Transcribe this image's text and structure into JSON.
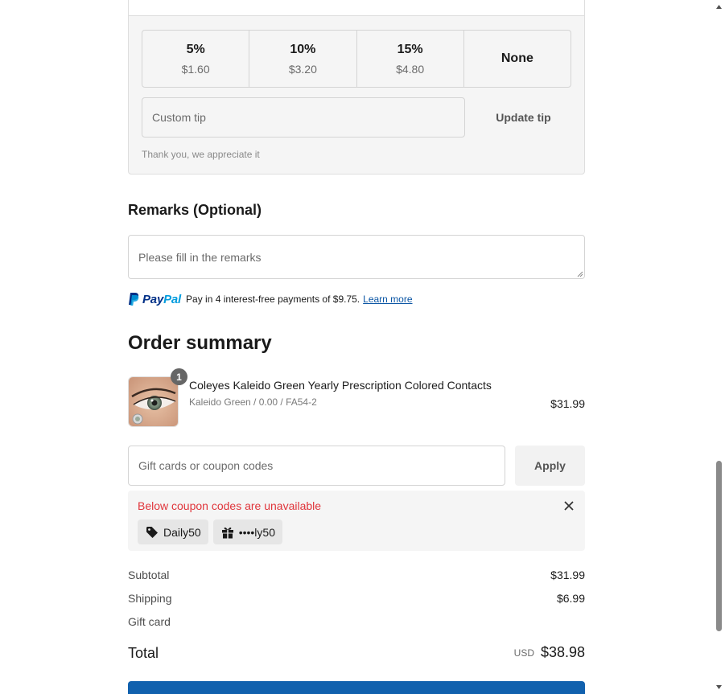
{
  "tip": {
    "options": [
      {
        "percent": "5%",
        "amount": "$1.60"
      },
      {
        "percent": "10%",
        "amount": "$3.20"
      },
      {
        "percent": "15%",
        "amount": "$4.80"
      }
    ],
    "none_label": "None",
    "custom_placeholder": "Custom tip",
    "update_label": "Update tip",
    "thanks_text": "Thank you, we appreciate it"
  },
  "remarks": {
    "title": "Remarks (Optional)",
    "placeholder": "Please fill in the remarks"
  },
  "paypal": {
    "logo_pay": "Pay",
    "logo_pal": "Pal",
    "message": "Pay in 4 interest-free payments of $9.75.",
    "learn_more": "Learn more",
    "brand_dark": "#003087",
    "brand_light": "#009cde"
  },
  "order_summary": {
    "title": "Order summary",
    "product": {
      "quantity": "1",
      "name": "Coleyes Kaleido Green Yearly Prescription Colored Contacts",
      "variant": "Kaleido Green / 0.00 / FA54-2",
      "price": "$31.99"
    },
    "coupon": {
      "placeholder": "Gift cards or coupon codes",
      "apply_label": "Apply"
    },
    "unavailable": {
      "message": "Below coupon codes are unavailable",
      "codes": [
        {
          "icon": "tag-icon",
          "label": "Daily50"
        },
        {
          "icon": "gift-icon",
          "label": "••••ly50"
        }
      ],
      "message_color": "#e0353b"
    },
    "subtotal_label": "Subtotal",
    "subtotal_value": "$31.99",
    "shipping_label": "Shipping",
    "shipping_value": "$6.99",
    "giftcard_label": "Gift card",
    "total_label": "Total",
    "total_currency": "USD",
    "total_value": "$38.98"
  },
  "colors": {
    "accent": "#1161ae"
  }
}
